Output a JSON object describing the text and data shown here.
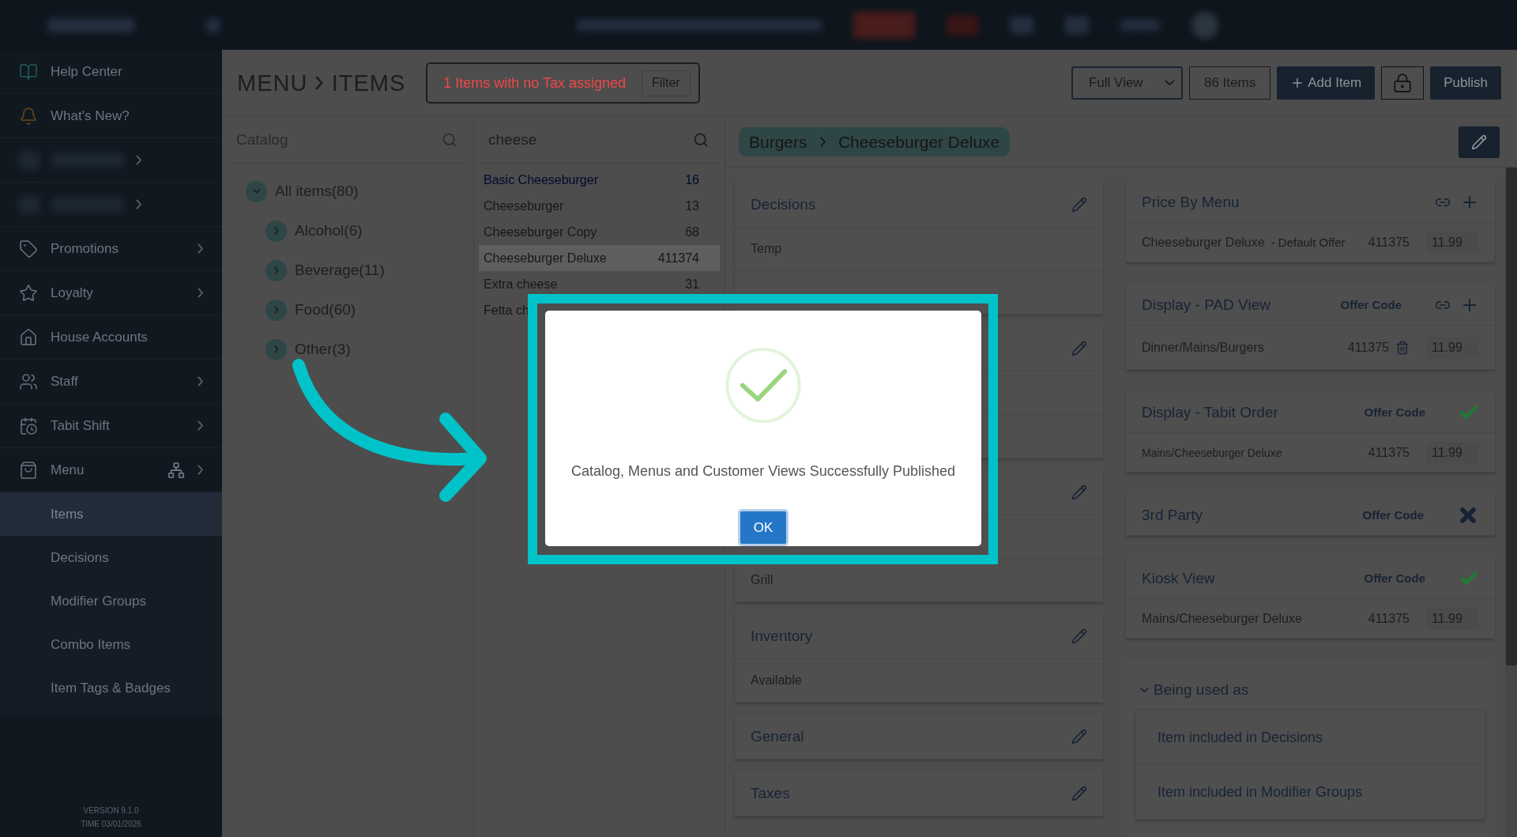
{
  "sidebar": {
    "items": [
      {
        "label": "Help Center",
        "has_submenu": false,
        "blurred": false
      },
      {
        "label": "What's New?",
        "has_submenu": false,
        "blurred": false
      },
      {
        "blurred": true,
        "has_submenu": true
      },
      {
        "blurred": true,
        "has_submenu": true
      },
      {
        "label": "Promotions",
        "has_submenu": true,
        "blurred": false
      },
      {
        "label": "Loyalty",
        "has_submenu": true,
        "blurred": false
      },
      {
        "label": "House Accounts",
        "has_submenu": false,
        "blurred": false
      },
      {
        "label": "Staff",
        "has_submenu": true,
        "blurred": false
      },
      {
        "label": "Tabit Shift",
        "has_submenu": true,
        "blurred": false
      },
      {
        "label": "Menu",
        "has_submenu": true,
        "blurred": false,
        "expanded": true,
        "children": [
          {
            "label": "Items",
            "selected": true
          },
          {
            "label": "Decisions",
            "selected": false
          },
          {
            "label": "Modifier Groups",
            "selected": false
          },
          {
            "label": "Combo Items",
            "selected": false
          },
          {
            "label": "Item Tags & Badges",
            "selected": false
          }
        ]
      }
    ],
    "version": "VERSION 9.1.0",
    "time": "TIME 03/01/2026"
  },
  "header": {
    "title": "MENU",
    "subtitle": "ITEMS",
    "alert": "1  Items with no Tax assigned",
    "alert_button": "Filter",
    "view_select": "Full View",
    "count": "86 Items",
    "add_button": "Add Item",
    "publish_button": "Publish"
  },
  "catalog": {
    "placeholder": "Catalog",
    "tree": {
      "label": "All items(80)",
      "expanded": true,
      "children": [
        {
          "label": "Alcohol(6)",
          "expanded": false
        },
        {
          "label": "Beverage(11)",
          "expanded": false
        },
        {
          "label": "Food(60)",
          "expanded": false
        },
        {
          "label": "Other(3)",
          "expanded": false
        }
      ]
    }
  },
  "item_list": {
    "search": "cheese",
    "rows": [
      {
        "name": "Basic Cheeseburger",
        "code": "16",
        "highlighted": true,
        "selected": false
      },
      {
        "name": "Cheeseburger",
        "code": "13",
        "highlighted": false,
        "selected": false
      },
      {
        "name": "Cheeseburger Copy",
        "code": "68",
        "highlighted": false,
        "selected": false
      },
      {
        "name": "Cheeseburger Deluxe",
        "code": "411374",
        "highlighted": false,
        "selected": true
      },
      {
        "name": "Extra cheese",
        "code": "31",
        "highlighted": false,
        "selected": false
      },
      {
        "name": "Fetta ch",
        "highlighted": false,
        "selected": false
      }
    ]
  },
  "breadcrumb": [
    "Burgers",
    "Cheeseburger Deluxe"
  ],
  "detail_cards": [
    {
      "kind": "covered_below",
      "title": "Decisions",
      "rows": [
        "Temp"
      ]
    },
    {
      "kind": "covered"
    },
    {
      "kind": "covered",
      "rows": [
        "Grill"
      ]
    },
    {
      "kind": "open",
      "title": "Inventory",
      "rows": [
        "Available"
      ]
    },
    {
      "kind": "open",
      "title": "General"
    },
    {
      "kind": "open",
      "title": "Taxes"
    }
  ],
  "channel_cards": [
    {
      "kind": "editable",
      "title": "Price By Menu",
      "rows": [
        {
          "name": "Cheeseburger Deluxe",
          "note": "- Default Offer",
          "code": "411375",
          "price": "11.99",
          "deletable": false,
          "small": false
        }
      ]
    },
    {
      "kind": "editable",
      "title": "Display - PAD View",
      "offer_label": "Offer Code",
      "rows": [
        {
          "name": "Dinner/Mains/Burgers",
          "code": "411375",
          "price": "11.99",
          "deletable": true,
          "small": false
        }
      ]
    },
    {
      "kind": "enabled",
      "title": "Display - Tabit Order",
      "offer_label": "Offer Code",
      "rows": [
        {
          "name": "Mains/Cheeseburger Deluxe",
          "code": "411375",
          "price": "11.99",
          "deletable": false,
          "small": true
        }
      ]
    },
    {
      "kind": "disabled",
      "title": "3rd Party",
      "offer_label": "Offer Code"
    },
    {
      "kind": "enabled",
      "title": "Kiosk View",
      "offer_label": "Offer Code",
      "rows": [
        {
          "name": "Mains/Cheeseburger Deluxe",
          "code": "411375",
          "price": "11.99",
          "deletable": false,
          "small": false
        }
      ]
    }
  ],
  "usage": {
    "title": "Being used as",
    "expanded": true,
    "items": [
      "Item included in Decisions",
      "Item included in Modifier Groups"
    ]
  },
  "dialog": {
    "message": "Catalog, Menus and Customer Views Successfully Published",
    "button": "OK"
  }
}
